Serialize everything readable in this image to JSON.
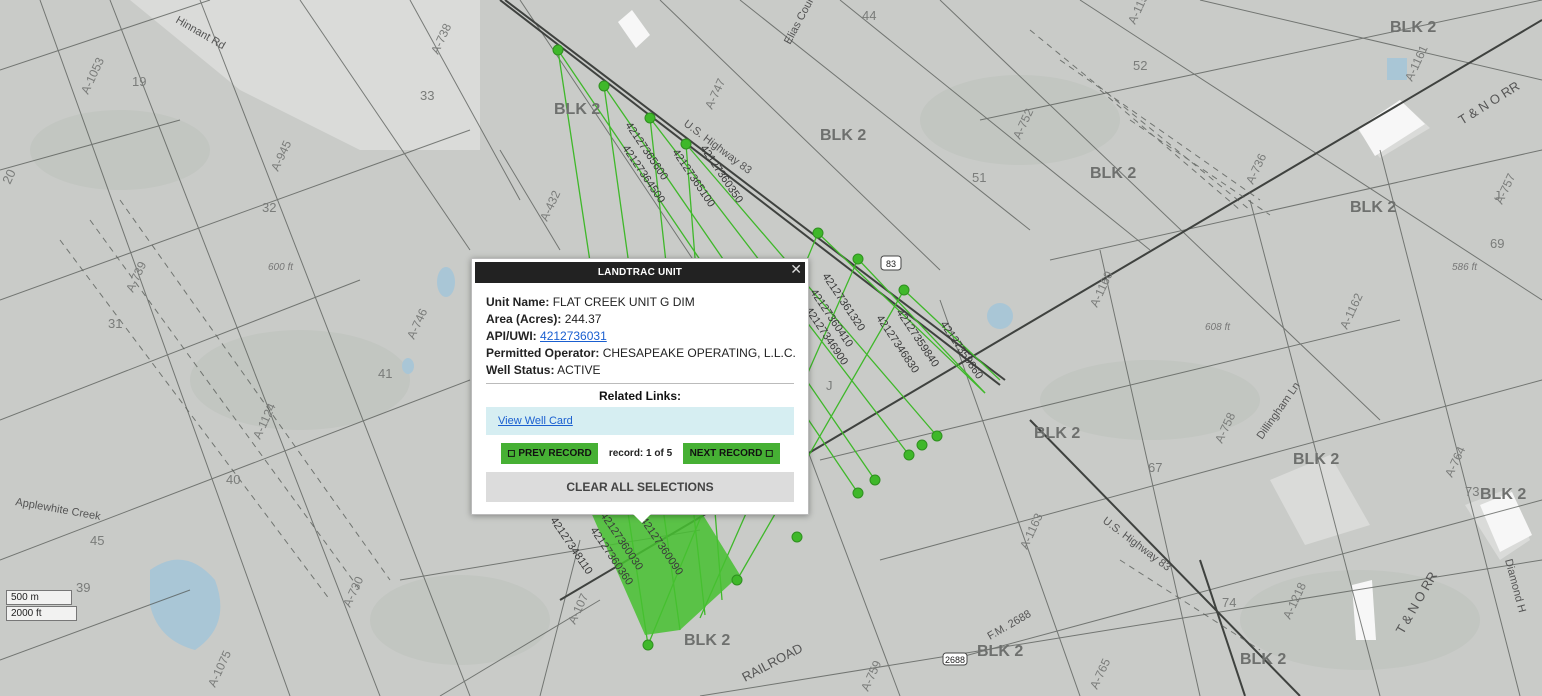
{
  "popup": {
    "title": "LANDTRAC UNIT",
    "close_glyph": "✕",
    "unit_name_label": "Unit Name:",
    "unit_name": "FLAT CREEK UNIT G DIM",
    "area_label": "Area (Acres):",
    "area": "244.37",
    "api_label": "API/UWI:",
    "api": "4212736031",
    "operator_label": "Permitted Operator:",
    "operator": "CHESAPEAKE OPERATING, L.L.C.",
    "status_label": "Well Status:",
    "status": "ACTIVE",
    "related_links_title": "Related Links:",
    "view_well_card": "View Well Card",
    "prev_label": "◻ PREV RECORD",
    "next_label": "NEXT RECORD ◻",
    "record_count": "record: 1 of 5",
    "clear_label": "CLEAR ALL SELECTIONS"
  },
  "scale": {
    "metric": "500 m",
    "imperial": "2000 ft"
  },
  "map": {
    "block_labels": [
      "BLK 2",
      "BLK 2",
      "BLK 2",
      "BLK 2",
      "BLK 2",
      "BLK 2",
      "BLK 2",
      "BLK 2",
      "BLK 2",
      "BLK 2",
      "BLK 2"
    ],
    "abstract_labels": [
      "A-1053",
      "A-738",
      "A-945",
      "A-739",
      "A-746",
      "A-1124",
      "A-730",
      "A-1075",
      "A-432",
      "A-747",
      "A-752",
      "A-1159",
      "A-1161",
      "A-757",
      "A-736",
      "A-1160",
      "A-1162",
      "A-758",
      "A-764",
      "A-1163",
      "A-1218",
      "A-759",
      "A-765",
      "A-107"
    ],
    "section_labels": [
      "19",
      "33",
      "20",
      "32",
      "31",
      "41",
      "40",
      "45",
      "39",
      "44",
      "52",
      "51",
      "69",
      "67",
      "73",
      "74",
      "J",
      "J"
    ],
    "well_numbers": [
      "42127364500",
      "42127365600",
      "42127365100",
      "42127360350",
      "42127361320",
      "42127360410",
      "42127346900",
      "42127346830",
      "42127359840",
      "42127359860",
      "42127348110",
      "42127360360",
      "42127360030",
      "42127360090"
    ],
    "roads": [
      "U.S. Highway 83",
      "U.S. Highway 83",
      "Elias Court",
      "Applewhite Creek",
      "Hinnant Rd",
      "Dillingham Ln",
      "F.M. 2688",
      "RAILROAD",
      "T & N O RR",
      "T & N O RR",
      "Diamond H"
    ],
    "shields": [
      "83",
      "2688"
    ],
    "elevations": [
      "600 ft",
      "608 ft",
      "586 ft"
    ]
  },
  "colors": {
    "map_bg": "#c9cbc8",
    "well_green": "#3fb82a",
    "popup_header": "#222222",
    "button_green": "#46b034"
  }
}
